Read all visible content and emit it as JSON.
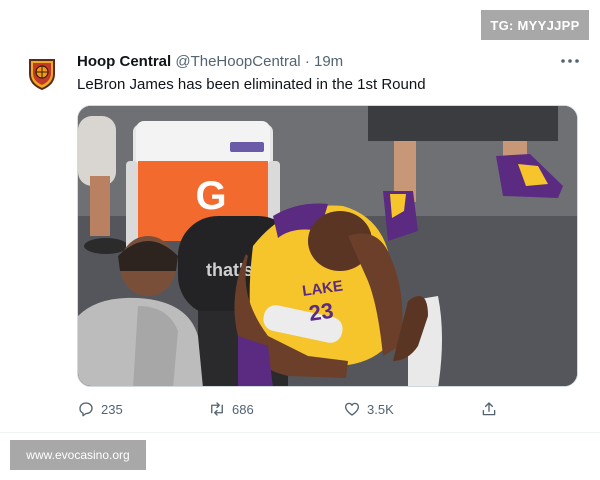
{
  "watermarks": {
    "top": "TG: MYYJJPP",
    "bottom": "www.evocasino.org"
  },
  "tweet": {
    "display_name": "Hoop Central",
    "handle": "@TheHoopCentral",
    "separator": "·",
    "timestamp": "19m",
    "text": "LeBron James has been eliminated in the 1st Round",
    "more_icon": "more-horizontal-icon",
    "media": {
      "cooler_brand": "G",
      "chair_text": "that's g",
      "jersey_text": "LAKE",
      "jersey_number": "23"
    },
    "actions": {
      "replies": "235",
      "retweets": "686",
      "likes": "3.5K"
    },
    "icons": [
      "reply-icon",
      "retweet-icon",
      "like-icon",
      "share-icon"
    ]
  },
  "colors": {
    "text_primary": "#0f1419",
    "text_secondary": "#536471",
    "lakers_gold": "#f6c52b",
    "lakers_purple": "#5b2b82",
    "gatorade_orange": "#f26a2e"
  }
}
